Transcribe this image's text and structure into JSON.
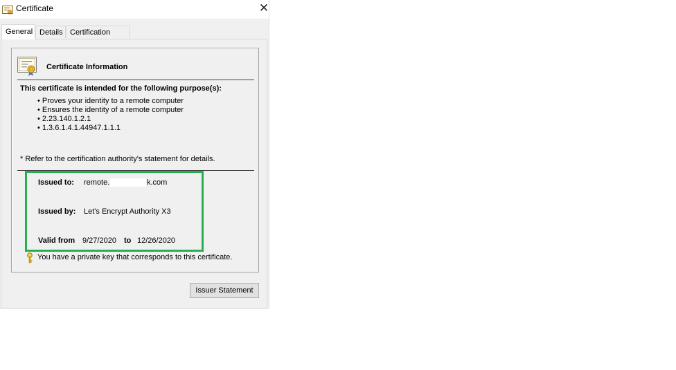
{
  "window": {
    "title": "Certificate",
    "close_glyph": "✕"
  },
  "tabs": [
    {
      "label": "General",
      "active": true
    },
    {
      "label": "Details",
      "active": false
    },
    {
      "label": "Certification Path",
      "active": false
    }
  ],
  "general": {
    "info_title": "Certificate Information",
    "purpose_heading": "This certificate is intended for the following purpose(s):",
    "purposes": [
      "Proves your identity to a remote computer",
      "Ensures the identity of a remote computer",
      "2.23.140.1.2.1",
      "1.3.6.1.4.1.44947.1.1.1"
    ],
    "note": "* Refer to the certification authority's statement for details.",
    "issued_to_label": "Issued to:",
    "issued_to_value_start": "remote.",
    "issued_to_value_end": "k.com",
    "issued_by_label": "Issued by:",
    "issued_by_value": "Let's Encrypt Authority X3",
    "valid_from_label": "Valid from",
    "valid_from_value": "9/27/2020",
    "valid_to_label": "to",
    "valid_to_value": "12/26/2020",
    "private_key_note": "You have a private key that corresponds to this certificate.",
    "issuer_statement_button": "Issuer Statement"
  },
  "icons": {
    "title": "certificate-icon",
    "info": "certificate-icon",
    "key": "key-icon"
  },
  "colors": {
    "highlight": "#27ae4f",
    "dialog_bg": "#f0f0f0"
  }
}
